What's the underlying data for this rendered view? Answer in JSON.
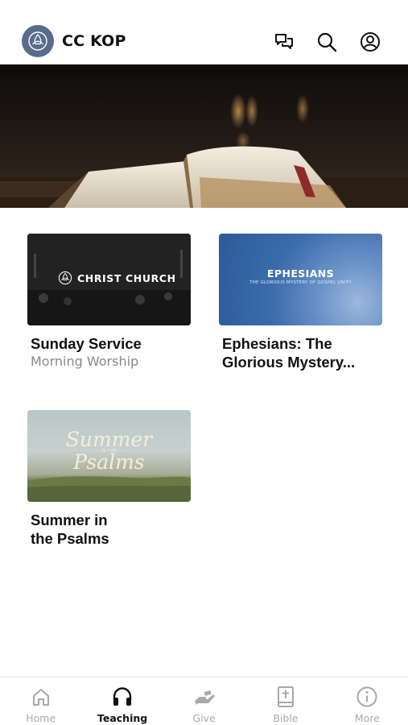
{
  "header": {
    "title": "CC KOP",
    "logo_icon": "trinity-knot-icon",
    "actions": [
      {
        "name": "chat-icon"
      },
      {
        "name": "search-icon"
      },
      {
        "name": "profile-icon"
      }
    ]
  },
  "hero": {
    "image": "open-bible-on-pulpit"
  },
  "cards": [
    {
      "title": "Sunday Service",
      "subtitle": "Morning Worship",
      "thumb_text": "CHRIST CHURCH"
    },
    {
      "title": "Ephesians: The Glorious Mystery...",
      "subtitle": "",
      "thumb_title": "EPHESIANS",
      "thumb_subtitle": "THE GLORIOUS MYSTERY OF GOSPEL UNITY"
    },
    {
      "title": "Summer in the Psalms",
      "title_line1": "Summer in",
      "title_line2": "the Psalms",
      "subtitle": "",
      "thumb_line1": "Summer",
      "thumb_mid": "— IN THE —",
      "thumb_line2": "Psalms"
    }
  ],
  "tabbar": {
    "active": "Teaching",
    "items": [
      {
        "label": "Home",
        "icon": "home-icon"
      },
      {
        "label": "Teaching",
        "icon": "headphones-icon"
      },
      {
        "label": "Give",
        "icon": "giving-hand-icon"
      },
      {
        "label": "Bible",
        "icon": "bible-icon"
      },
      {
        "label": "More",
        "icon": "info-icon"
      }
    ]
  },
  "colors": {
    "logo_bg": "#5a6b8c",
    "active_tab": "#111111",
    "inactive_tab": "#a8a8a8"
  }
}
